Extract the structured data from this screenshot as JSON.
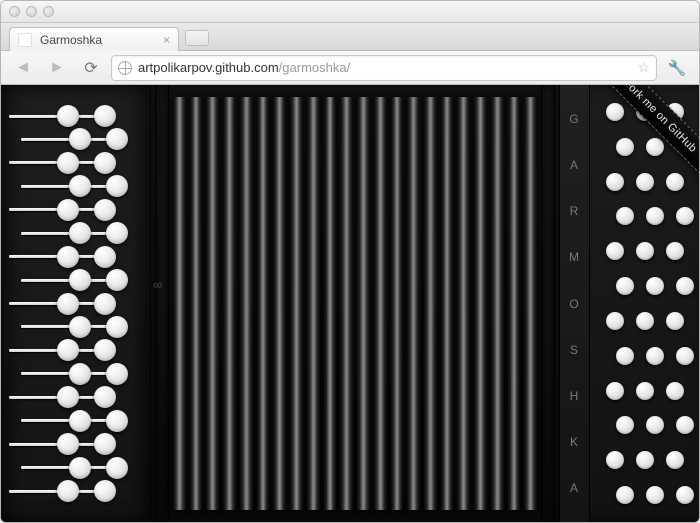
{
  "tab": {
    "title": "Garmoshka",
    "close_glyph": "×"
  },
  "url": {
    "host": "artpolikarpov.github.com",
    "path": "/garmoshka/"
  },
  "icons": {
    "back": "◄",
    "forward": "►",
    "reload": "⟳",
    "star": "☆",
    "wrench": "🔧"
  },
  "page": {
    "brand": "GARMOSHKA",
    "ribbon": "Fork me on GitHub",
    "infinity": "∞",
    "pleat_count": 22,
    "left_keys": 17,
    "right_button_rows": 12
  }
}
